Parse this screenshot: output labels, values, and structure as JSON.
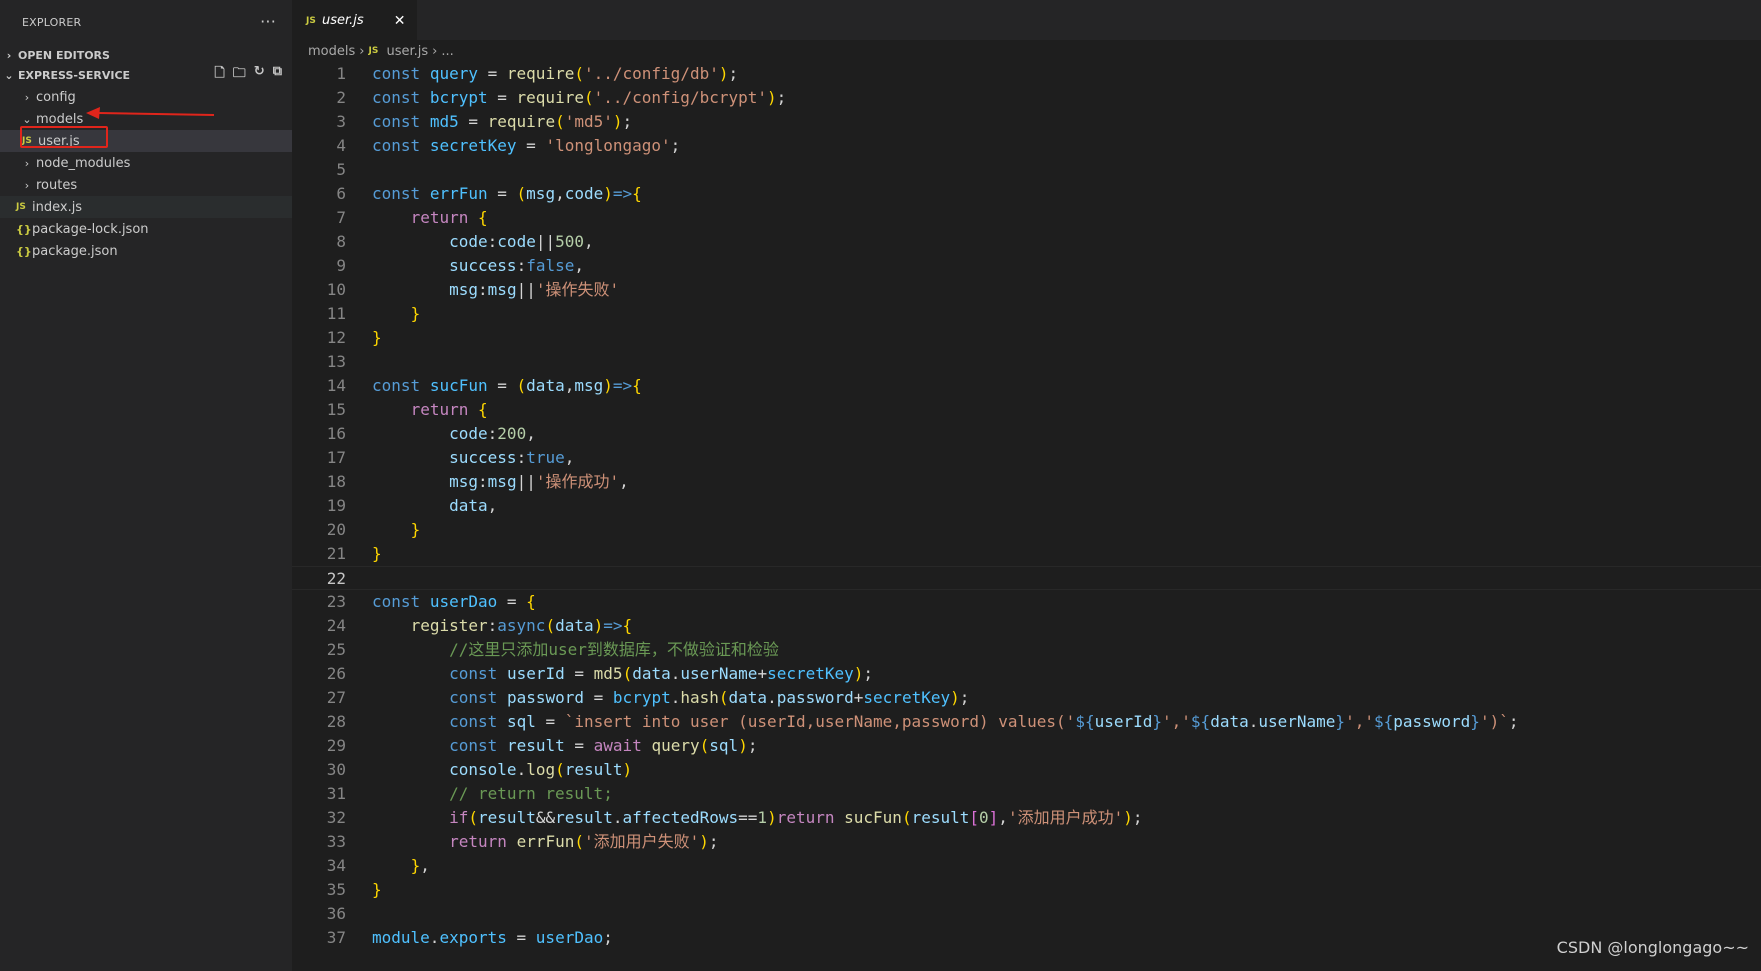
{
  "sidebar": {
    "title": "EXPLORER",
    "more": "···",
    "open_editors": "OPEN EDITORS",
    "project": "EXPRESS-SERVICE",
    "tree": [
      {
        "label": "config",
        "type": "folder",
        "chevron": "›"
      },
      {
        "label": "models",
        "type": "folder",
        "chevron": "⌄"
      },
      {
        "label": "user.js",
        "type": "js",
        "icon": "JS"
      },
      {
        "label": "node_modules",
        "type": "folder",
        "chevron": "›"
      },
      {
        "label": "routes",
        "type": "folder",
        "chevron": "›"
      },
      {
        "label": "index.js",
        "type": "js",
        "icon": "JS"
      },
      {
        "label": "package-lock.json",
        "type": "json",
        "icon": "{}"
      },
      {
        "label": "package.json",
        "type": "json",
        "icon": "{}"
      }
    ]
  },
  "editor": {
    "tab": {
      "icon": "JS",
      "label": "user.js",
      "close": "✕"
    },
    "breadcrumb": [
      "models",
      "›",
      "JS",
      "user.js",
      "›",
      "..."
    ]
  },
  "code_lines": [
    "const query = require('../config/db');",
    "const bcrypt = require('../config/bcrypt');",
    "const md5 = require('md5');",
    "const secretKey = 'longlongago';",
    "",
    "const errFun = (msg,code)=>{",
    "    return {",
    "        code:code||500,",
    "        success:false,",
    "        msg:msg||'操作失败'",
    "    }",
    "}",
    "",
    "const sucFun = (data,msg)=>{",
    "    return {",
    "        code:200,",
    "        success:true,",
    "        msg:msg||'操作成功',",
    "        data,",
    "    }",
    "}",
    "",
    "const userDao = {",
    "    register:async(data)=>{",
    "        //这里只添加user到数据库，不做验证和检验",
    "        const userId = md5(data.userName+secretKey);",
    "        const password = bcrypt.hash(data.password+secretKey);",
    "        const sql = `insert into user (userId,userName,password) values('${userId}','${data.userName}','${password}')`;",
    "        const result = await query(sql);",
    "        console.log(result)",
    "        // return result;",
    "        if(result&&result.affectedRows==1)return sucFun(result[0],'添加用户成功');",
    "        return errFun('添加用户失败');",
    "    },",
    "}",
    "",
    "module.exports = userDao;"
  ],
  "current_line": 22,
  "watermark": "CSDN @longlongago~~",
  "colors": {
    "annotation": "#e0251b",
    "editor_bg": "#1e1e1e",
    "sidebar_bg": "#252526"
  }
}
